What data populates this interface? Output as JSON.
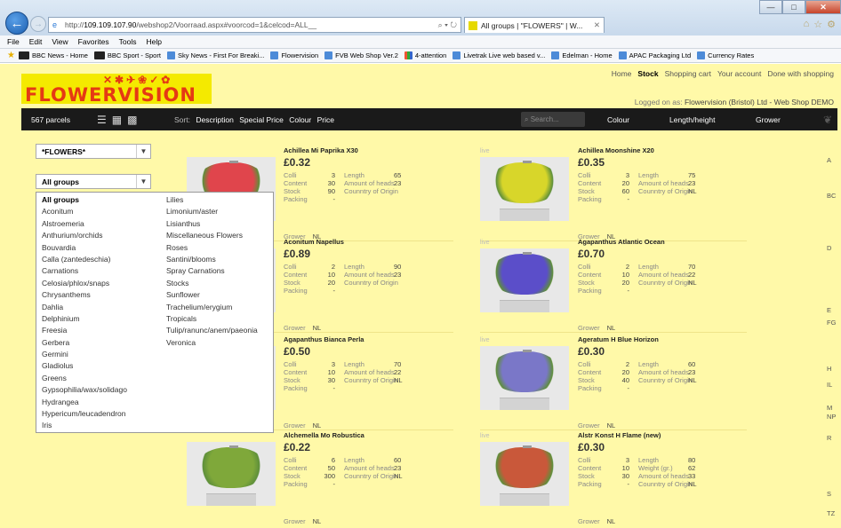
{
  "browser": {
    "url_prefix": "http://",
    "url_host": "109.109.107.90",
    "url_rest": "/webshop2/Voorraad.aspx#voorcod=1&celcod=ALL__",
    "tab_title": "All groups | \"FLOWERS\" | W...",
    "menu": [
      "File",
      "Edit",
      "View",
      "Favorites",
      "Tools",
      "Help"
    ],
    "favorites": [
      "BBC News - Home",
      "BBC Sport - Sport",
      "Sky News - First For Breaki...",
      "Flowervision",
      "FVB Web Shop Ver.2",
      "4-attention",
      "Livetrak Live web based v...",
      "Edelman - Home",
      "APAC Packaging Ltd",
      "Currency Rates"
    ]
  },
  "site": {
    "logo_symbols": "✕✱✈❀✓✿",
    "logo_text": "FLOWERVISION",
    "nav": [
      "Home",
      "Stock",
      "Shopping cart",
      "Your account",
      "Done with shopping"
    ],
    "logged_label": "Logged on as:",
    "logged_user": "Flowervision (Bristol) Ltd - Web Shop DEMO"
  },
  "bar": {
    "parcels": "567 parcels",
    "sort_label": "Sort:",
    "sort_options": [
      "Description",
      "Special Price",
      "Colour",
      "Price"
    ],
    "search_placeholder": "Search...",
    "col_colour": "Colour",
    "col_length": "Length/height",
    "col_grower": "Grower"
  },
  "filters": {
    "type_select": "*FLOWERS*",
    "group_select": "All groups",
    "groups_col1": [
      "All groups",
      "Aconitum",
      "Alstroemeria",
      "Anthurium/orchids",
      "Bouvardia",
      "Calla (zantedeschia)",
      "Carnations",
      "Celosia/phlox/snaps",
      "Chrysanthems",
      "Dahlia",
      "Delphinium",
      "Freesia",
      "Gerbera",
      "Germini",
      "Gladiolus",
      "Greens",
      "Gypsophilia/wax/solidago",
      "Hydrangea",
      "Hypericum/leucadendron",
      "Iris"
    ],
    "groups_col2": [
      "Lilies",
      "Limonium/aster",
      "Lisianthus",
      "Miscellaneous Flowers",
      "Roses",
      "Santini/blooms",
      "Spray Carnations",
      "Stocks",
      "Sunflower",
      "Trachelium/erygium",
      "Tropicals",
      "Tulip/ranunc/anem/paeonia",
      "Veronica"
    ]
  },
  "labels": {
    "colli": "Colli",
    "content": "Content",
    "stock": "Stock",
    "packing": "Packing",
    "length": "Length",
    "heads": "Amount of heads",
    "origin": "Counntry of Origin",
    "weight": "Weight (gr.)",
    "grower": "Grower",
    "live": "live"
  },
  "products": [
    {
      "name": "Achillea Mi Paprika X30",
      "price": "£0.32",
      "colli": "3",
      "content": "30",
      "stock": "90",
      "packing": "-",
      "length": "65",
      "heads": "23",
      "origin": "",
      "grower": "NL",
      "color": "#e0454c"
    },
    {
      "name": "Achillea Moonshine X20",
      "price": "£0.35",
      "colli": "3",
      "content": "20",
      "stock": "60",
      "packing": "-",
      "length": "75",
      "heads": "23",
      "origin": "NL",
      "grower": "NL",
      "color": "#d8d62a"
    },
    {
      "name": "Aconitum Napellus",
      "price": "£0.89",
      "colli": "2",
      "content": "10",
      "stock": "20",
      "packing": "-",
      "length": "90",
      "heads": "23",
      "origin": "",
      "grower": "NL",
      "color": "#5a4fb0"
    },
    {
      "name": "Agapanthus Atlantic Ocean",
      "price": "£0.70",
      "colli": "2",
      "content": "10",
      "stock": "20",
      "packing": "-",
      "length": "70",
      "heads": "22",
      "origin": "NL",
      "grower": "NL",
      "color": "#5b4ec9"
    },
    {
      "name": "Agapanthus Bianca Perla",
      "price": "£0.50",
      "colli": "3",
      "content": "10",
      "stock": "30",
      "packing": "-",
      "length": "70",
      "heads": "22",
      "origin": "NL",
      "grower": "NL",
      "color": "#f0f0f0"
    },
    {
      "name": "Ageratum H Blue Horizon",
      "price": "£0.30",
      "colli": "2",
      "content": "20",
      "stock": "40",
      "packing": "-",
      "length": "60",
      "heads": "23",
      "origin": "NL",
      "grower": "NL",
      "color": "#7a77c8"
    },
    {
      "name": "Alchemella Mo Robustica",
      "price": "£0.22",
      "colli": "6",
      "content": "50",
      "stock": "300",
      "packing": "-",
      "length": "60",
      "heads": "23",
      "origin": "NL",
      "grower": "NL",
      "color": "#7fa83a"
    },
    {
      "name": "Alstr Konst H Flame (new)",
      "price": "£0.30",
      "colli": "3",
      "content": "10",
      "stock": "30",
      "packing": "-",
      "length": "80",
      "weight": "62",
      "heads": "33",
      "origin": "NL",
      "grower": "NL",
      "color": "#c9583a"
    }
  ],
  "right_cut": [
    "A",
    "BC",
    "D",
    "E",
    "FG",
    "H",
    "IL",
    "M",
    "NP",
    "R",
    "S",
    "TZ"
  ]
}
